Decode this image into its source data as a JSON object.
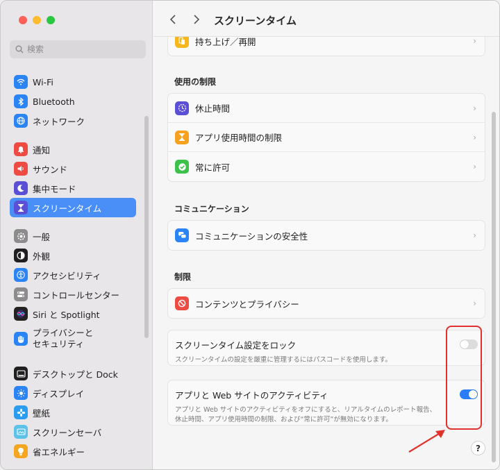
{
  "sidebar": {
    "search_placeholder": "検索",
    "groups": [
      [
        {
          "label": "Wi-Fi",
          "icon": "wifi-icon",
          "color": "#2b84f6"
        },
        {
          "label": "Bluetooth",
          "icon": "bluetooth-icon",
          "color": "#2b84f6"
        },
        {
          "label": "ネットワーク",
          "icon": "globe-icon",
          "color": "#2b84f6"
        }
      ],
      [
        {
          "label": "通知",
          "icon": "bell-icon",
          "color": "#ee4b43"
        },
        {
          "label": "サウンド",
          "icon": "speaker-icon",
          "color": "#ee4b43"
        },
        {
          "label": "集中モード",
          "icon": "moon-icon",
          "color": "#5b4fd6"
        },
        {
          "label": "スクリーンタイム",
          "icon": "hourglass-icon",
          "color": "#5b4fd6",
          "active": true
        }
      ],
      [
        {
          "label": "一般",
          "icon": "gear-icon",
          "color": "#8c8c8c"
        },
        {
          "label": "外観",
          "icon": "appearance-icon",
          "color": "#1f1f1f"
        },
        {
          "label": "アクセシビリティ",
          "icon": "accessibility-icon",
          "color": "#2b84f6"
        },
        {
          "label": "コントロールセンター",
          "icon": "control-center-icon",
          "color": "#8c8c8c"
        },
        {
          "label": "Siri と Spotlight",
          "icon": "siri-icon",
          "color": "#222222"
        },
        {
          "label": "プライバシーと\nセキュリティ",
          "icon": "hand-icon",
          "color": "#2b84f6",
          "tall": true
        }
      ],
      [
        {
          "label": "デスクトップと Dock",
          "icon": "dock-icon",
          "color": "#1f1f1f"
        },
        {
          "label": "ディスプレイ",
          "icon": "sun-icon",
          "color": "#2b84f6"
        },
        {
          "label": "壁紙",
          "icon": "flower-icon",
          "color": "#2b9cf0"
        },
        {
          "label": "スクリーンセーバ",
          "icon": "screensaver-icon",
          "color": "#5cc2e8"
        },
        {
          "label": "省エネルギー",
          "icon": "bulb-icon",
          "color": "#f4a623"
        }
      ]
    ]
  },
  "header": {
    "title": "スクリーンタイム"
  },
  "partial_row": {
    "label": "持ち上げ／再開",
    "icon": "pickups-icon",
    "color": "#f6b71e"
  },
  "sections": [
    {
      "title": "使用の制限",
      "rows": [
        {
          "label": "休止時間",
          "icon": "downtime-icon",
          "color": "#5b4fd6"
        },
        {
          "label": "アプリ使用時間の制限",
          "icon": "hourglass-icon",
          "color": "#f6a21e"
        },
        {
          "label": "常に許可",
          "icon": "checkmark-icon",
          "color": "#3cc24a"
        }
      ]
    },
    {
      "title": "コミュニケーション",
      "rows": [
        {
          "label": "コミュニケーションの安全性",
          "icon": "chat-bubbles-icon",
          "color": "#2b84f6"
        }
      ]
    },
    {
      "title": "制限",
      "rows": [
        {
          "label": "コンテンツとプライバシー",
          "icon": "restriction-icon",
          "color": "#ee4b43"
        }
      ]
    }
  ],
  "toggles": [
    {
      "title": "スクリーンタイム設定をロック",
      "desc": [
        "スクリーンタイムの設定を厳重に管理するにはパスコードを使用します。"
      ],
      "on": false
    },
    {
      "title": "アプリと Web サイトのアクティビティ",
      "desc": [
        "アプリと Web サイトのアクティビティをオフにすると、リアルタイムのレポート報告、",
        "休止時間、アプリ使用時間の制限、および“常に許可”が無効になります。"
      ],
      "on": true
    }
  ],
  "help_label": "?",
  "accent_color": "#2a7ef5",
  "annotation_color": "#e0312d"
}
